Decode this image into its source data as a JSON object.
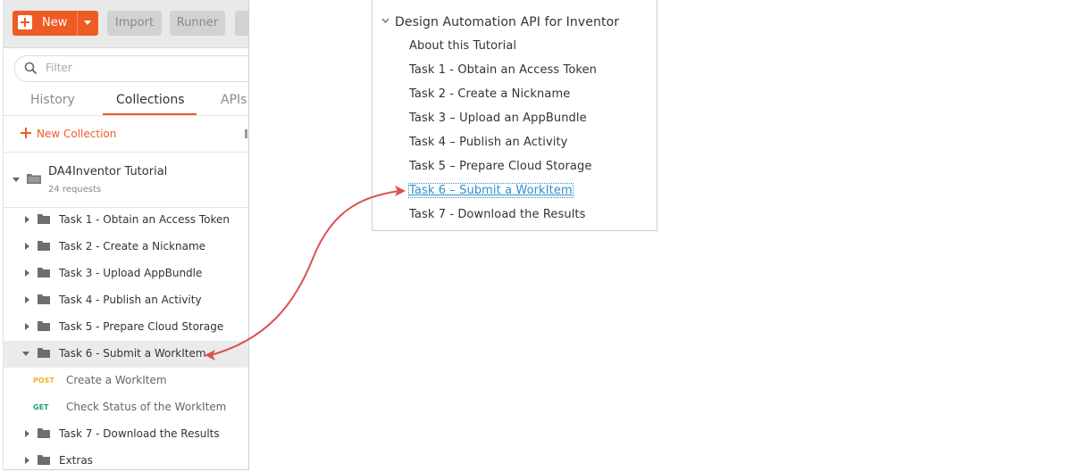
{
  "toolbar": {
    "new_label": "New",
    "import_label": "Import",
    "runner_label": "Runner"
  },
  "sidebar": {
    "search_placeholder": "Filter",
    "tabs": [
      {
        "label": "History"
      },
      {
        "label": "Collections"
      },
      {
        "label": "APIs"
      }
    ],
    "new_collection_label": "New Collection",
    "collection": {
      "name": "DA4Inventor Tutorial",
      "count": "24 requests",
      "folders": [
        {
          "label": "Task 1 - Obtain an Access Token"
        },
        {
          "label": "Task 2 - Create a Nickname"
        },
        {
          "label": "Task 3 - Upload AppBundle"
        },
        {
          "label": "Task 4 - Publish an Activity"
        },
        {
          "label": "Task 5 - Prepare Cloud Storage"
        },
        {
          "label": "Task 6 - Submit a WorkItem"
        },
        {
          "label": "Task 7 - Download the Results"
        },
        {
          "label": "Extras"
        }
      ],
      "requests": [
        {
          "method": "POST",
          "label": "Create a WorkItem",
          "color": "#f0b429"
        },
        {
          "method": "GET",
          "label": "Check Status of the WorkItem",
          "color": "#17a86c"
        }
      ]
    }
  },
  "toc": {
    "title": "Design Automation API for Inventor",
    "items": [
      {
        "label": "About this Tutorial"
      },
      {
        "label": "Task 1 - Obtain an Access Token"
      },
      {
        "label": "Task 2 - Create a Nickname"
      },
      {
        "label": "Task 3 – Upload an AppBundle"
      },
      {
        "label": "Task 4 – Publish an Activity"
      },
      {
        "label": "Task 5 – Prepare Cloud Storage"
      },
      {
        "label": "Task 6 – Submit a WorkItem"
      },
      {
        "label": "Task 7 - Download the Results"
      }
    ]
  },
  "colors": {
    "accent": "#ef5b25",
    "link": "#2f8fc7",
    "arrow": "#d9534f"
  }
}
